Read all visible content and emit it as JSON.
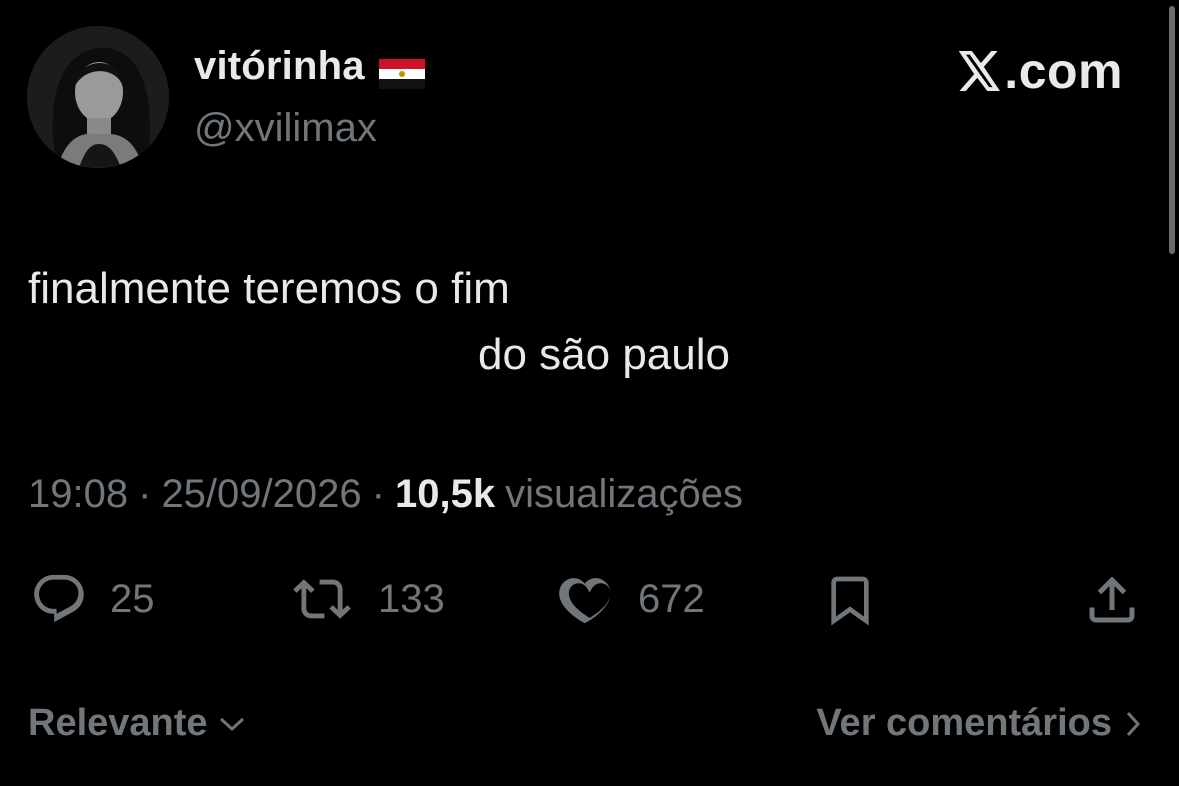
{
  "author": {
    "display_name": "vitórinha",
    "handle": "@xvilimax",
    "flag_icon": "flag-icon-red-white-black"
  },
  "brand": {
    "label": ".com",
    "logo_icon": "x-logo-icon"
  },
  "tweet": {
    "line1": "finalmente teremos o fim",
    "line2": "do são paulo"
  },
  "meta": {
    "time": "19:08",
    "separator": "·",
    "date": "25/09/2026",
    "views_count": "10,5k",
    "views_label": "visualizações"
  },
  "actions": {
    "replies": "25",
    "reposts": "133",
    "likes": "672"
  },
  "footer": {
    "sort_label": "Relevante",
    "comments_label": "Ver comentários"
  },
  "colors": {
    "background": "#000000",
    "text": "#e7e9ea",
    "muted": "#71767b"
  }
}
